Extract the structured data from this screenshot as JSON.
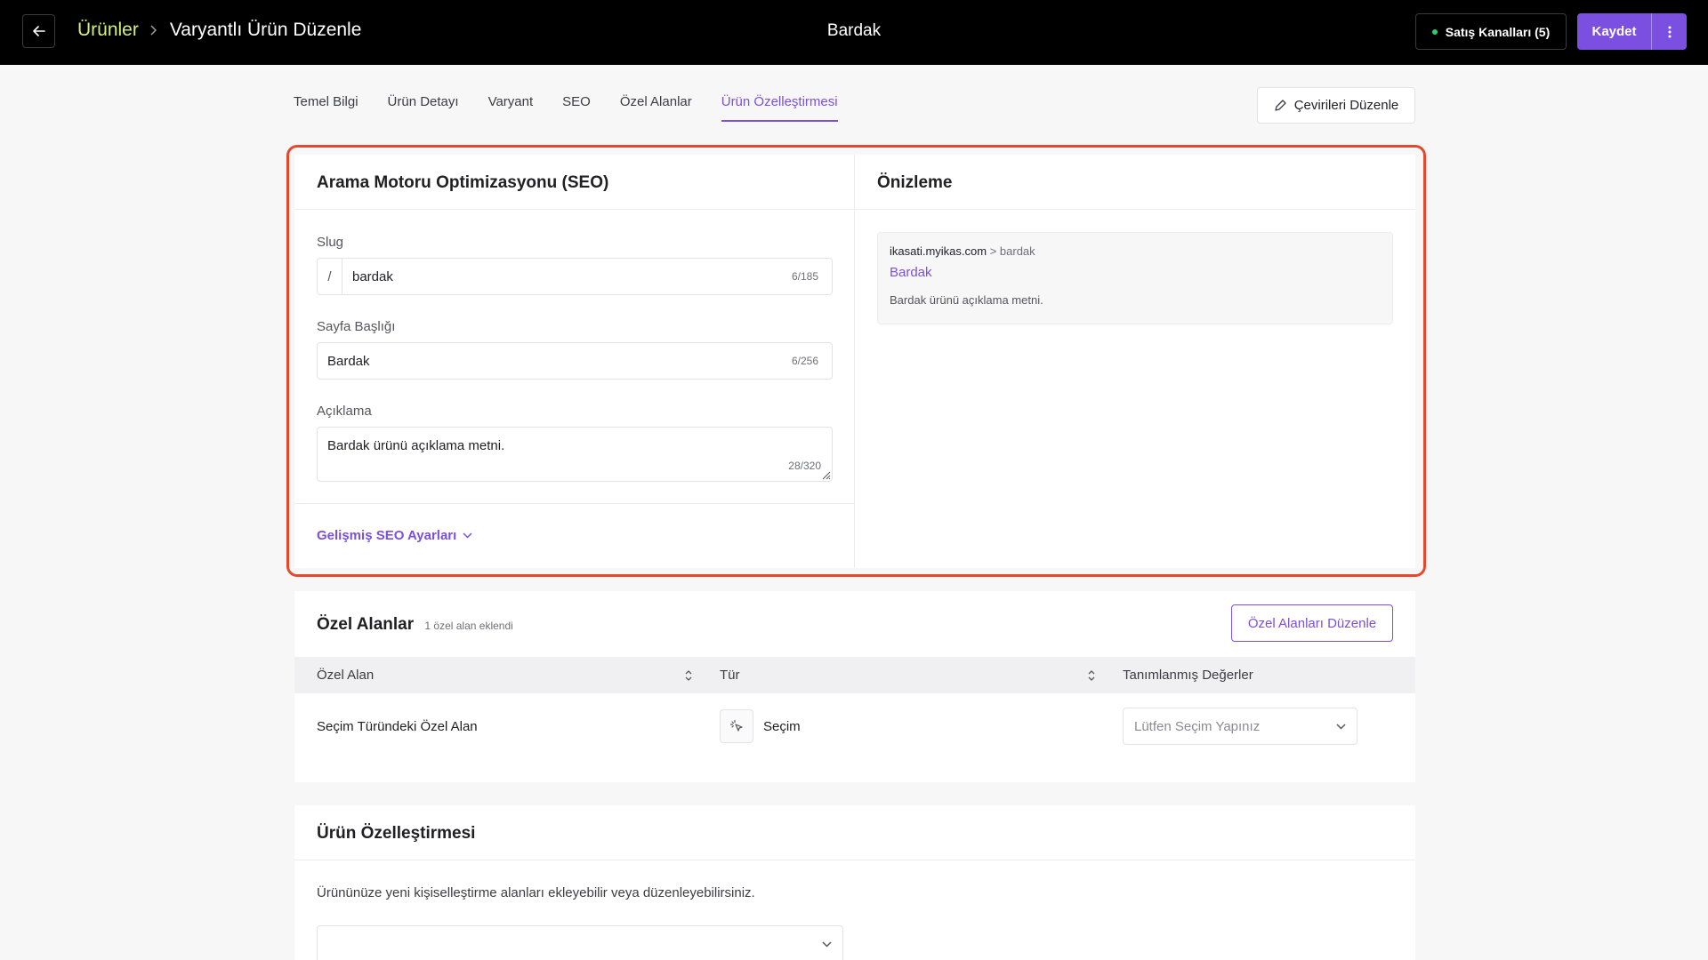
{
  "colors": {
    "accent": "#7b4fe0",
    "breadcrumb_link": "#d4f07a",
    "highlight_border": "#e5482c",
    "status_dot": "#2ecc71"
  },
  "header": {
    "back_icon": "arrow-left-icon",
    "breadcrumb_root": "Ürünler",
    "breadcrumb_current": "Varyantlı Ürün Düzenle",
    "center_title": "Bardak",
    "sales_channels_label": "Satış Kanalları (5)",
    "save_label": "Kaydet",
    "more_icon": "more-vertical-icon"
  },
  "tabs": [
    {
      "label": "Temel Bilgi",
      "active": false
    },
    {
      "label": "Ürün Detayı",
      "active": false
    },
    {
      "label": "Varyant",
      "active": false
    },
    {
      "label": "SEO",
      "active": false
    },
    {
      "label": "Özel Alanlar",
      "active": false
    },
    {
      "label": "Ürün Özelleştirmesi",
      "active": true
    }
  ],
  "translate_button": "Çevirileri Düzenle",
  "seo": {
    "title": "Arama Motoru Optimizasyonu (SEO)",
    "slug": {
      "label": "Slug",
      "prefix": "/",
      "value": "bardak",
      "counter": "6/185"
    },
    "page_title": {
      "label": "Sayfa Başlığı",
      "value": "Bardak",
      "counter": "6/256"
    },
    "description": {
      "label": "Açıklama",
      "value": "Bardak ürünü açıklama metni.",
      "counter": "28/320"
    },
    "advanced_link": "Gelişmiş SEO Ayarları"
  },
  "preview": {
    "title": "Önizleme",
    "domain": "ikasati.myikas.com",
    "path": "> bardak",
    "page_title": "Bardak",
    "description": "Bardak ürünü açıklama metni."
  },
  "custom_fields": {
    "title": "Özel Alanlar",
    "subtitle": "1 özel alan eklendi",
    "edit_button": "Özel Alanları Düzenle",
    "columns": [
      "Özel Alan",
      "Tür",
      "Tanımlanmış Değerler"
    ],
    "rows": [
      {
        "name": "Seçim Türündeki Özel Alan",
        "type": "Seçim",
        "type_icon": "pointer-click-icon",
        "value_placeholder": "Lütfen Seçim Yapınız"
      }
    ]
  },
  "product_customization": {
    "title": "Ürün Özelleştirmesi",
    "description": "Ürününüze yeni kişiselleştirme alanları ekleyebilir veya düzenleyebilirsiniz."
  }
}
